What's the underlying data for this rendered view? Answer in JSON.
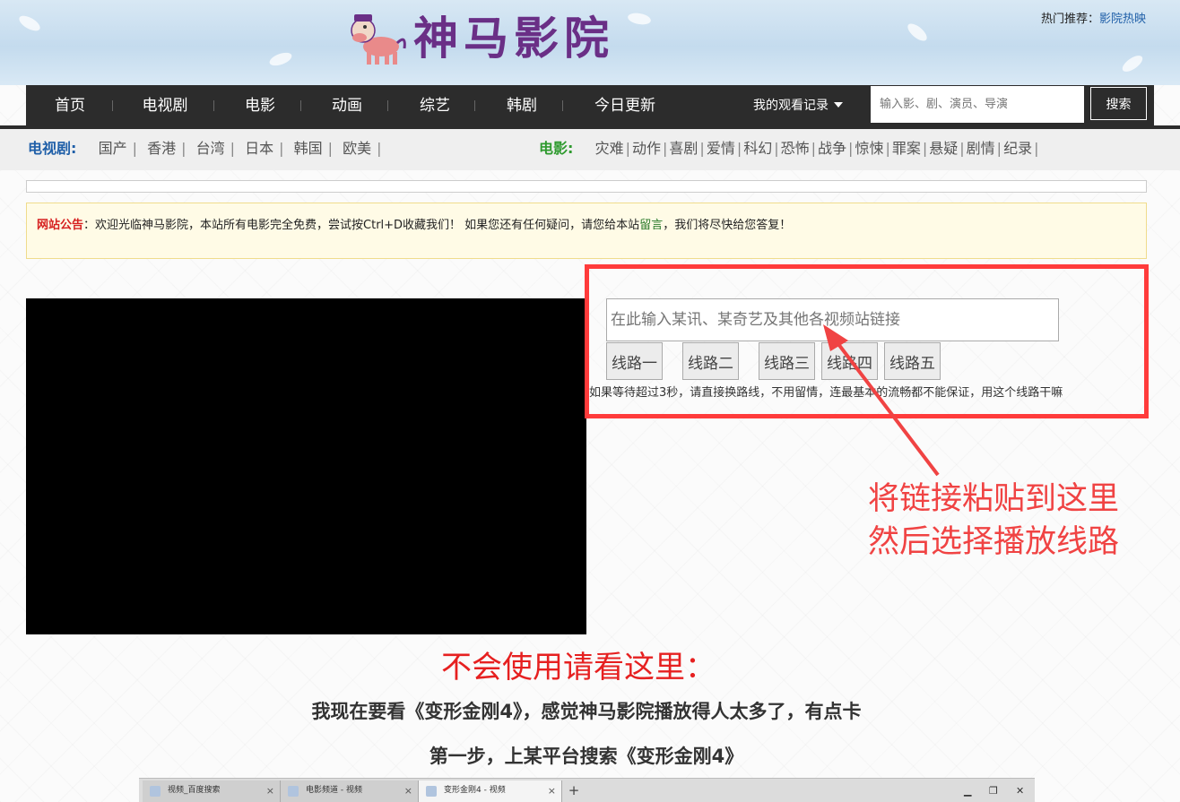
{
  "header": {
    "site_name": "神马影院",
    "hot_label": "热门推荐：",
    "hot_link": "影院热映"
  },
  "nav": {
    "items": [
      "首页",
      "电视剧",
      "电影",
      "动画",
      "综艺",
      "韩剧",
      "今日更新"
    ],
    "history": "我的观看记录",
    "search_placeholder": "输入影、剧、演员、导演",
    "search_button": "搜索"
  },
  "categories": {
    "tv_title": "电视剧:",
    "tv": [
      "国产",
      "香港",
      "台湾",
      "日本",
      "韩国",
      "欧美"
    ],
    "movie_title": "电影:",
    "movie": [
      "灾难",
      "动作",
      "喜剧",
      "爱情",
      "科幻",
      "恐怖",
      "战争",
      "惊悚",
      "罪案",
      "悬疑",
      "剧情",
      "纪录"
    ]
  },
  "notice": {
    "label": "网站公告",
    "text_before": "：欢迎光临神马影院，本站所有电影完全免费，尝试按Ctrl+D收藏我们！ 如果您还有任何疑问，请您给本站",
    "link": "留言",
    "text_after": "，我们将尽快给您答复！"
  },
  "parser": {
    "placeholder": "在此输入某讯、某奇艺及其他各视频站链接",
    "buttons": [
      "线路一",
      "线路二",
      "线路三",
      "线路四",
      "线路五"
    ],
    "tip": "如果等待超过3秒，请直接换路线，不用留情，连最基本的流畅都不能保证，用这个线路干嘛"
  },
  "annotation": {
    "line1": "将链接粘贴到这里",
    "line2": "然后选择播放线路"
  },
  "guide": {
    "heading": "不会使用请看这里：",
    "step_intro": "我现在要看《变形金刚4》，感觉神马影院播放得人太多了，有点卡",
    "step1": "第一步，上某平台搜索《变形金刚4》"
  },
  "browser_tabs": {
    "tabs": [
      "视频_百度搜索",
      "电影频道 - 视频",
      "变形金刚4 - 视频"
    ],
    "close": "×",
    "new_tab": "+"
  },
  "colors": {
    "accent_red": "#ff3b3b",
    "logo_purple": "#6a2f86",
    "nav_bg": "#2c2c2c",
    "tv_title": "#1f5fa8",
    "movie_title": "#2e9a2e"
  }
}
